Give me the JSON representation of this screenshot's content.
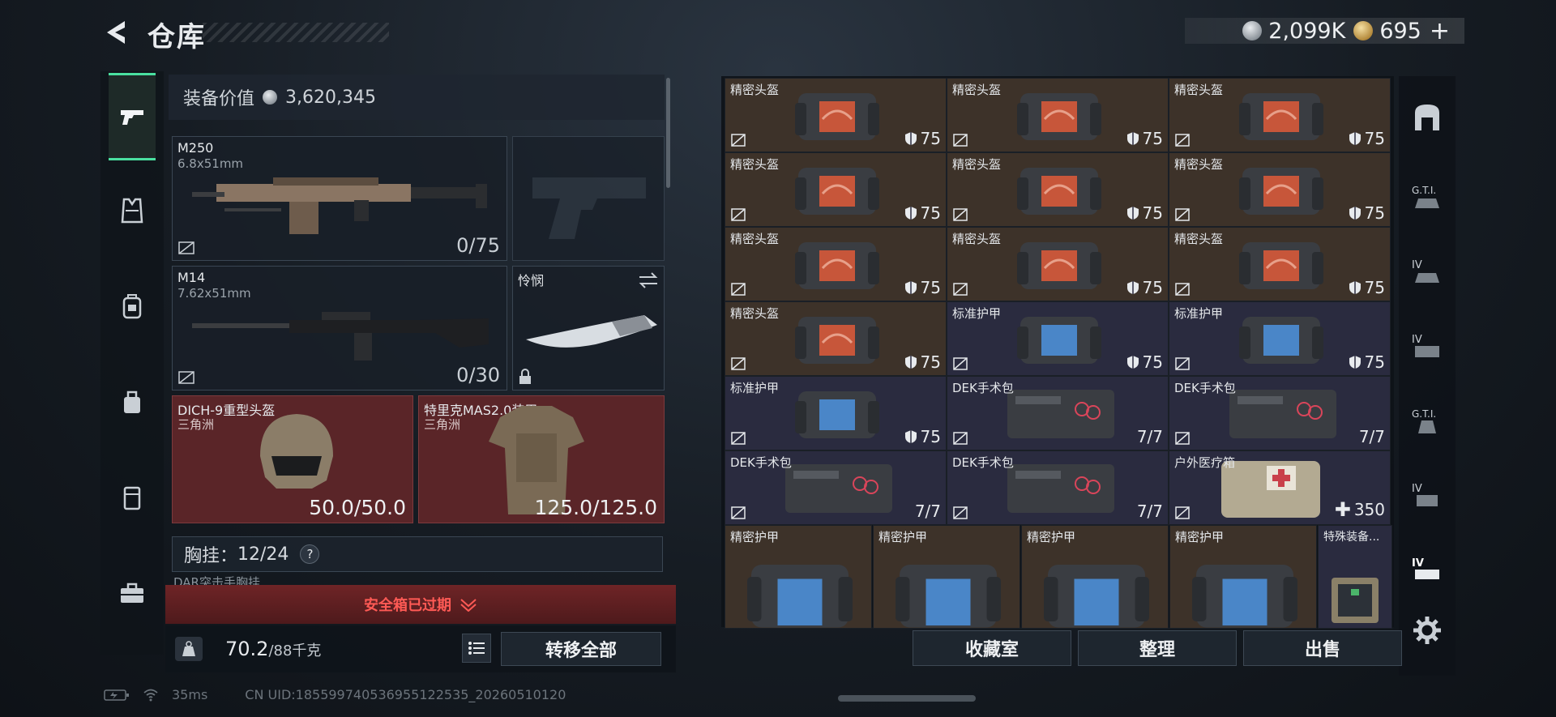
{
  "header": {
    "title": "仓库",
    "currencies": [
      {
        "icon": "silver-coin-icon",
        "value": "2,099K"
      },
      {
        "icon": "gold-coin-icon",
        "value": "695"
      }
    ],
    "add_label": "+"
  },
  "left_nav": {
    "items": [
      "pistol-icon",
      "vest-icon",
      "backpack-icon",
      "bag-icon",
      "case-icon",
      "toolbox-icon"
    ],
    "active_index": 0
  },
  "loadout": {
    "equip_value_label": "装备价值",
    "equip_value": "3,620,345",
    "primary": {
      "name": "M250",
      "caliber": "6.8x51mm",
      "ammo": "0/75"
    },
    "secondary": {
      "name": "M14",
      "caliber": "7.62x51mm",
      "ammo": "0/30"
    },
    "melee": {
      "name": "怜悯"
    },
    "helmet": {
      "name": "DICH-9重型头盔",
      "origin": "三角洲",
      "durability": "50.0/50.0"
    },
    "armor": {
      "name": "特里克MAS2.0装甲",
      "origin": "三角洲",
      "durability": "125.0/125.0"
    },
    "chest_label": "胸挂：",
    "chest_value": "12/24",
    "chest_help": "?",
    "partial_row_label": "DAR突击手胸挂",
    "expired_text": "安全箱已过期",
    "weight_value": "70.2",
    "weight_max": "/88千克",
    "weight_icon_label": "KG",
    "transfer_all": "转移全部"
  },
  "storage": {
    "rows": [
      [
        {
          "name": "精密头盔",
          "value": "75",
          "color": "brown",
          "type": "helmet"
        },
        {
          "name": "精密头盔",
          "value": "75",
          "color": "brown",
          "type": "helmet"
        },
        {
          "name": "精密头盔",
          "value": "75",
          "color": "brown",
          "type": "helmet"
        }
      ],
      [
        {
          "name": "精密头盔",
          "value": "75",
          "color": "brown",
          "type": "helmet"
        },
        {
          "name": "精密头盔",
          "value": "75",
          "color": "brown",
          "type": "helmet"
        },
        {
          "name": "精密头盔",
          "value": "75",
          "color": "brown",
          "type": "helmet"
        }
      ],
      [
        {
          "name": "精密头盔",
          "value": "75",
          "color": "brown",
          "type": "helmet"
        },
        {
          "name": "精密头盔",
          "value": "75",
          "color": "brown",
          "type": "helmet"
        },
        {
          "name": "精密头盔",
          "value": "75",
          "color": "brown",
          "type": "helmet"
        }
      ],
      [
        {
          "name": "精密头盔",
          "value": "75",
          "color": "brown",
          "type": "helmet"
        },
        {
          "name": "标准护甲",
          "value": "75",
          "color": "navy",
          "type": "armor"
        },
        {
          "name": "标准护甲",
          "value": "75",
          "color": "navy",
          "type": "armor"
        }
      ],
      [
        {
          "name": "标准护甲",
          "value": "75",
          "color": "navy",
          "type": "armor"
        },
        {
          "name": "DEK手术包",
          "value": "7/7",
          "color": "navy",
          "type": "kit"
        },
        {
          "name": "DEK手术包",
          "value": "7/7",
          "color": "navy",
          "type": "kit"
        }
      ],
      [
        {
          "name": "DEK手术包",
          "value": "7/7",
          "color": "navy",
          "type": "kit"
        },
        {
          "name": "DEK手术包",
          "value": "7/7",
          "color": "navy",
          "type": "kit"
        },
        {
          "name": "户外医疗箱",
          "value": "350",
          "color": "navy",
          "type": "medbox"
        }
      ]
    ],
    "big_row": [
      {
        "name": "精密护甲"
      },
      {
        "name": "精密护甲"
      },
      {
        "name": "精密护甲"
      },
      {
        "name": "精密护甲"
      }
    ],
    "special": {
      "name": "特殊装备..."
    }
  },
  "right_nav": [
    "armor-icon",
    "gti-icon",
    "iv-icon",
    "iv-icon",
    "gti-icon",
    "iv-icon",
    "iv-icon",
    "gear-icon"
  ],
  "actions": {
    "collection": "收藏室",
    "sort": "整理",
    "sell": "出售"
  },
  "status": {
    "ping": "35ms",
    "uid": "CN UID:1855997405369551225​35_20260510120"
  },
  "colors": {
    "accent": "#4ae0a0",
    "brown_cell": "#3d3229",
    "navy_cell": "#2a2b3f",
    "red_slot": "#5a2528",
    "expired": "#ff5a55"
  }
}
